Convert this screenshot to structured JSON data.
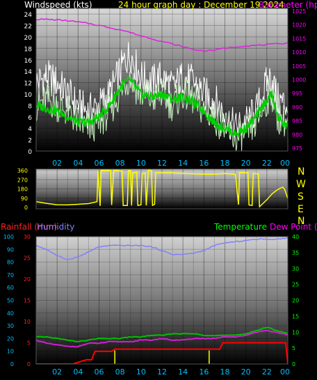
{
  "header": {
    "wind_title": "Windspeed (kts)",
    "date_title": "24 hour graph day : December 19 2024",
    "baro_title": "Barometer (hpa)"
  },
  "panel3_header": {
    "rain_title": "Rainfall (mm)",
    "humidity_title": "Humidity",
    "temp_title": "Temperature",
    "dew_title": "Dew Point (c)"
  },
  "compass": [
    "N",
    "W",
    "S",
    "E",
    "N"
  ],
  "hour_labels": [
    "02",
    "04",
    "06",
    "08",
    "10",
    "12",
    "14",
    "16",
    "18",
    "20",
    "22",
    "00"
  ],
  "colors": {
    "wind_gust": "#ffffff",
    "wind_avg": "#c8f0c0",
    "wind_mean_line": "#00d000",
    "barometer": "#e020e0",
    "direction": "#ffff00",
    "humidity": "#8080ff",
    "temperature": "#00c000",
    "dewpoint": "#d020d0",
    "rain": "#ff0000",
    "rain_rate": "#c8c800",
    "left_axis": "#00c0ff",
    "rain_axis": "#ff2020",
    "temp_axis": "#00ff00",
    "title_yellow": "#ffff00",
    "title_magenta": "#ff00ff",
    "title_green": "#00ff00",
    "title_humidity": "#8080ff"
  },
  "chart_data": [
    {
      "type": "line",
      "name": "wind-barometer",
      "x_hours": [
        0,
        1,
        2,
        3,
        4,
        5,
        6,
        7,
        8,
        8.5,
        9,
        9.5,
        10,
        11,
        12,
        13,
        14,
        15,
        16,
        17,
        18,
        19,
        20,
        21,
        22,
        22.5,
        23,
        24
      ],
      "series": [
        {
          "name": "",
          "role": "gust",
          "values": [
            12,
            13,
            12,
            10,
            8,
            7,
            8,
            10,
            14,
            16,
            17,
            15,
            13,
            12,
            13,
            11,
            13,
            12,
            10,
            9,
            6,
            4,
            5,
            7,
            12,
            13,
            9,
            8
          ]
        },
        {
          "name": "",
          "role": "average",
          "values": [
            8,
            9,
            8,
            7,
            5,
            4,
            5,
            7,
            10,
            12,
            13,
            11,
            10,
            9,
            10,
            8,
            10,
            9,
            7,
            6,
            4,
            2,
            3,
            5,
            9,
            10,
            6,
            5
          ]
        },
        {
          "name": "",
          "role": "mean",
          "values": [
            8,
            7.5,
            7,
            6,
            5,
            5,
            6,
            8,
            11,
            12,
            12.5,
            11,
            10,
            9.5,
            10,
            9,
            9.5,
            8.5,
            7,
            5,
            4,
            3,
            4,
            6,
            9,
            10,
            6,
            4
          ]
        }
      ],
      "barometer": {
        "x_hours": [
          0,
          1,
          2,
          3,
          4,
          5,
          6,
          7,
          8,
          9,
          10,
          11,
          12,
          13,
          14,
          15,
          16,
          17,
          18,
          19,
          20,
          21,
          22,
          23,
          24
        ],
        "values": [
          1022,
          1022,
          1021.8,
          1021.5,
          1021,
          1020.5,
          1019.8,
          1019,
          1018.2,
          1017.2,
          1016,
          1015,
          1014,
          1013,
          1012,
          1011,
          1010.5,
          1010.8,
          1011.5,
          1012,
          1012.3,
          1012.5,
          1012.8,
          1013,
          1013.5
        ]
      },
      "ylim_wind": [
        0,
        25
      ],
      "yticks_wind": [
        0,
        2,
        4,
        6,
        8,
        10,
        12,
        14,
        16,
        18,
        20,
        22,
        24
      ],
      "ylim_baro": [
        974,
        1026
      ],
      "yticks_baro": [
        975,
        980,
        985,
        990,
        995,
        1000,
        1005,
        1010,
        1015,
        1020,
        1025
      ],
      "xlim": [
        0,
        24
      ]
    },
    {
      "type": "line",
      "name": "wind-direction",
      "points": [
        [
          0,
          60
        ],
        [
          1,
          35
        ],
        [
          2,
          25
        ],
        [
          3,
          30
        ],
        [
          4,
          35
        ],
        [
          5,
          40
        ],
        [
          5.8,
          50
        ],
        [
          5.9,
          360
        ],
        [
          6.1,
          20
        ],
        [
          6.2,
          360
        ],
        [
          7.1,
          360
        ],
        [
          7.2,
          20
        ],
        [
          7.4,
          360
        ],
        [
          8.2,
          360
        ],
        [
          8.3,
          20
        ],
        [
          8.7,
          20
        ],
        [
          8.8,
          360
        ],
        [
          9.0,
          360
        ],
        [
          9.1,
          20
        ],
        [
          9.2,
          330
        ],
        [
          9.6,
          340
        ],
        [
          9.7,
          20
        ],
        [
          10.0,
          20
        ],
        [
          10.1,
          330
        ],
        [
          10.4,
          330
        ],
        [
          10.5,
          20
        ],
        [
          10.7,
          360
        ],
        [
          11.0,
          360
        ],
        [
          11.1,
          20
        ],
        [
          11.3,
          30
        ],
        [
          11.4,
          340
        ],
        [
          13.0,
          340
        ],
        [
          13.1,
          330
        ],
        [
          16.0,
          330
        ],
        [
          17.0,
          320
        ],
        [
          18.0,
          330
        ],
        [
          19.0,
          320
        ],
        [
          19.3,
          30
        ],
        [
          19.4,
          340
        ],
        [
          20.2,
          340
        ],
        [
          20.3,
          20
        ],
        [
          20.6,
          20
        ],
        [
          20.7,
          330
        ],
        [
          21.2,
          330
        ],
        [
          21.3,
          10
        ],
        [
          22.0,
          70
        ],
        [
          22.5,
          130
        ],
        [
          23.0,
          170
        ],
        [
          23.5,
          200
        ],
        [
          23.7,
          180
        ],
        [
          24,
          90
        ]
      ],
      "ylim": [
        0,
        360
      ],
      "yticks": [
        0,
        90,
        180,
        270,
        360
      ],
      "xlim": [
        0,
        24
      ]
    },
    {
      "type": "line",
      "name": "humidity-temperature-rain",
      "humidity": {
        "x_hours": [
          0,
          1,
          2,
          3,
          4,
          5,
          6,
          7,
          8,
          9,
          10,
          11,
          12,
          13,
          14,
          15,
          16,
          17,
          18,
          19,
          20,
          21,
          22,
          23,
          24
        ],
        "values": [
          93,
          90,
          85,
          82,
          84,
          88,
          92,
          93,
          93,
          93,
          93,
          92,
          89,
          86,
          86,
          87,
          89,
          93,
          95,
          96,
          97,
          98,
          98,
          98,
          99
        ]
      },
      "temperature": {
        "x_hours": [
          0,
          1,
          2,
          3,
          4,
          5,
          6,
          7,
          8,
          9,
          10,
          11,
          12,
          13,
          14,
          15,
          16,
          17,
          18,
          19,
          20,
          21,
          22,
          23,
          24
        ],
        "values": [
          8.5,
          8.5,
          8,
          7.5,
          7,
          7.5,
          8,
          8,
          8,
          8.5,
          8.5,
          9,
          9,
          9.5,
          9.5,
          9.5,
          9,
          9,
          9,
          9,
          9.5,
          10.5,
          11.5,
          10.5,
          9.5
        ]
      },
      "dewpoint": {
        "x_hours": [
          0,
          1,
          2,
          3,
          4,
          5,
          6,
          7,
          8,
          9,
          10,
          11,
          12,
          13,
          14,
          15,
          16,
          17,
          18,
          19,
          20,
          21,
          22,
          23,
          24
        ],
        "values": [
          7.5,
          6.5,
          6,
          5.5,
          5.5,
          6.5,
          6.5,
          7,
          7,
          7,
          7.5,
          7.5,
          8,
          7.5,
          7.5,
          8,
          8,
          8,
          8.5,
          8.5,
          9,
          10,
          10.5,
          10,
          9
        ]
      },
      "rain_cumulative": {
        "points": [
          [
            0,
            0
          ],
          [
            3.5,
            0
          ],
          [
            4.8,
            1
          ],
          [
            5.3,
            1
          ],
          [
            5.6,
            3
          ],
          [
            7.2,
            3
          ],
          [
            7.5,
            3.5
          ],
          [
            17.5,
            3.5
          ],
          [
            17.8,
            5
          ],
          [
            23.8,
            5
          ],
          [
            24,
            0
          ]
        ]
      },
      "rain_rate_ticks": [
        7.5,
        16.5
      ],
      "ylim_left": [
        0,
        100
      ],
      "yticks_left": [
        0,
        10,
        20,
        30,
        40,
        50,
        60,
        70,
        80,
        90,
        100
      ],
      "ylim_rain": [
        0,
        30
      ],
      "yticks_rain": [
        0,
        5,
        10,
        15,
        20,
        25,
        30
      ],
      "ylim_temp": [
        0,
        40
      ],
      "yticks_temp": [
        0,
        5,
        10,
        15,
        20,
        25,
        30,
        35,
        40
      ],
      "xlim": [
        0,
        24
      ]
    }
  ]
}
